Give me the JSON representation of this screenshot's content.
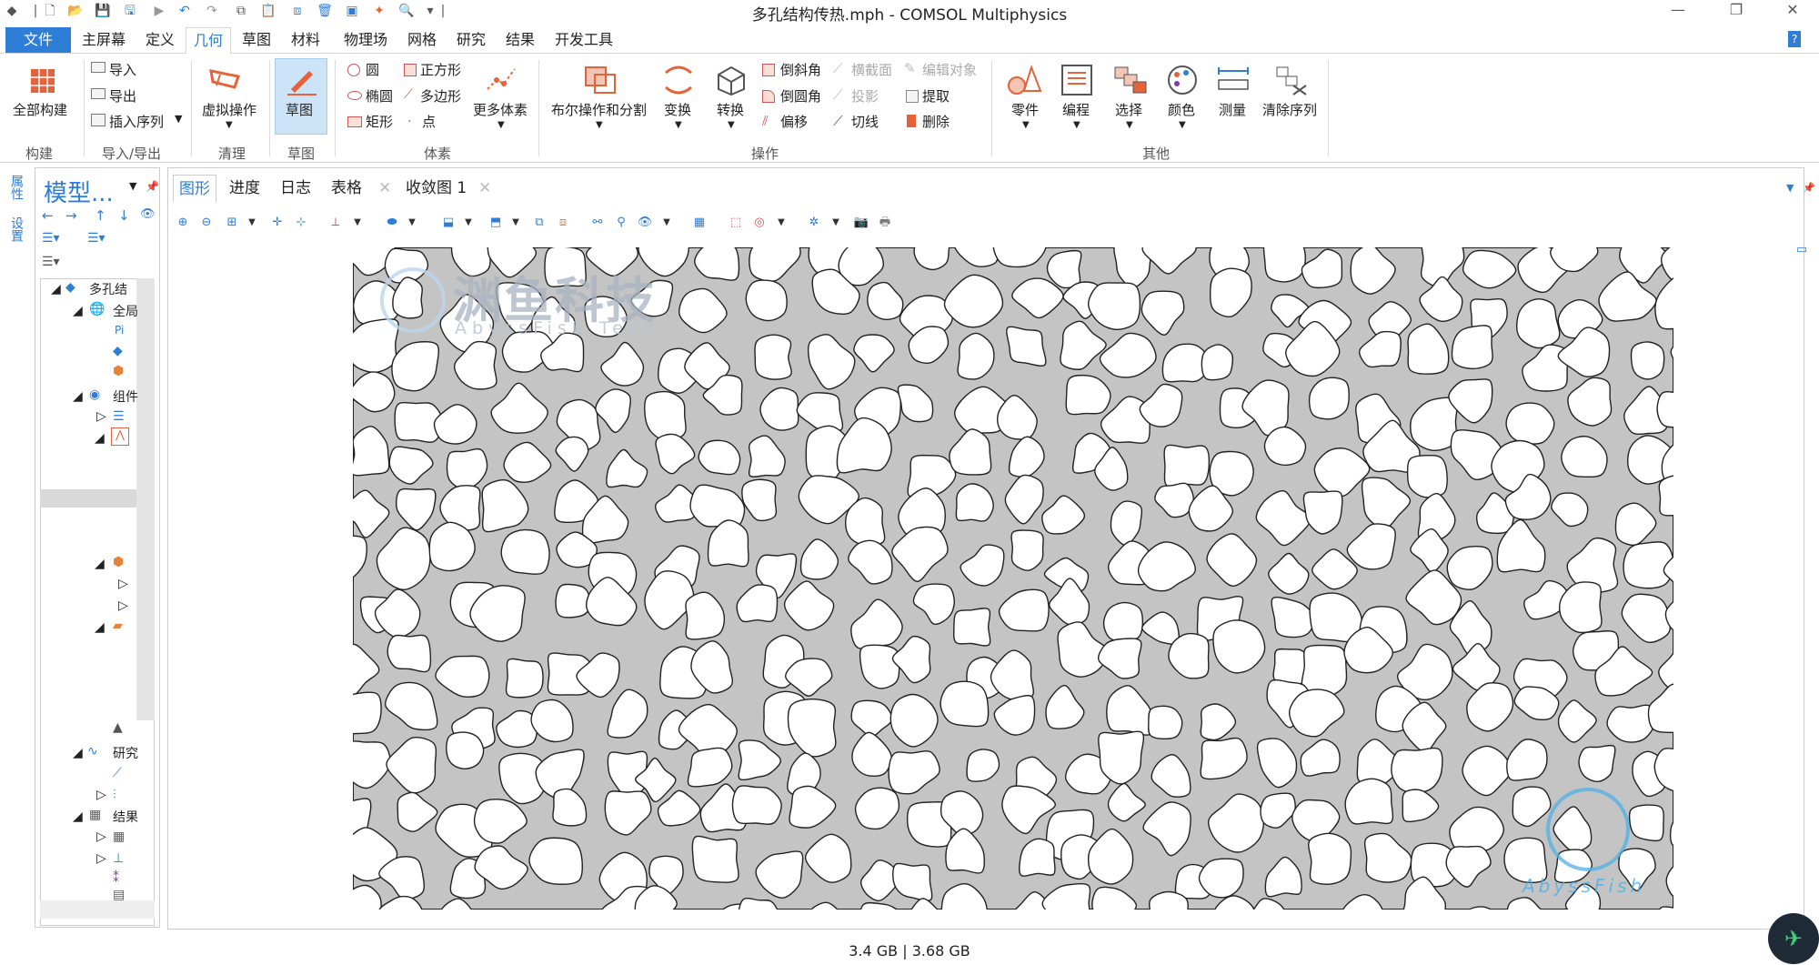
{
  "window": {
    "title": "多孔结构传热.mph - COMSOL Multiphysics",
    "minimize": "—",
    "restore": "❐",
    "close": "✕"
  },
  "menu": {
    "file": "文件",
    "items": [
      "主屏幕",
      "定义",
      "几何",
      "草图",
      "材料",
      "物理场",
      "网格",
      "研究",
      "结果",
      "开发工具"
    ],
    "help": "?"
  },
  "ribbon": {
    "build": {
      "build_all": "全部构建",
      "group": "构建"
    },
    "import": {
      "import": "导入",
      "export": "导出",
      "insert_seq": "插入序列",
      "group": "导入/导出"
    },
    "cleanup": {
      "virtual": "虚拟操作",
      "group": "清理"
    },
    "sketch": {
      "sketch": "草图",
      "group": "草图"
    },
    "primitives": {
      "circle": "圆",
      "square": "正方形",
      "ellipse": "椭圆",
      "polygon": "多边形",
      "rect": "矩形",
      "point": "点",
      "more": "更多体素",
      "group": "体素"
    },
    "ops": {
      "boolean": "布尔操作和分割",
      "transform": "变换",
      "convert": "转换",
      "chamfer": "倒斜角",
      "fillet": "倒圆角",
      "offset": "偏移",
      "cross": "横截面",
      "project": "投影",
      "tangent": "切线",
      "edit": "编辑对象",
      "extract": "提取",
      "delete": "删除",
      "group": "操作"
    },
    "other": {
      "parts": "零件",
      "program": "编程",
      "select": "选择",
      "color": "颜色",
      "measure": "测量",
      "clear": "清除序列",
      "group": "其他"
    }
  },
  "side_tabs": [
    "属性",
    "设置"
  ],
  "model": {
    "title": "模型...",
    "tree": [
      "多孔结",
      "全局",
      "Pi",
      "组件",
      "研究",
      "结果"
    ]
  },
  "tabs": [
    {
      "label": "图形"
    },
    {
      "label": "进度"
    },
    {
      "label": "日志"
    },
    {
      "label": "表格"
    },
    {
      "label": "收敛图 1"
    }
  ],
  "watermark": {
    "cn": "渊鱼科技",
    "en": "AbyssFish Tech",
    "logo": "AbyssFish"
  },
  "status": "3.4 GB | 3.68 GB"
}
